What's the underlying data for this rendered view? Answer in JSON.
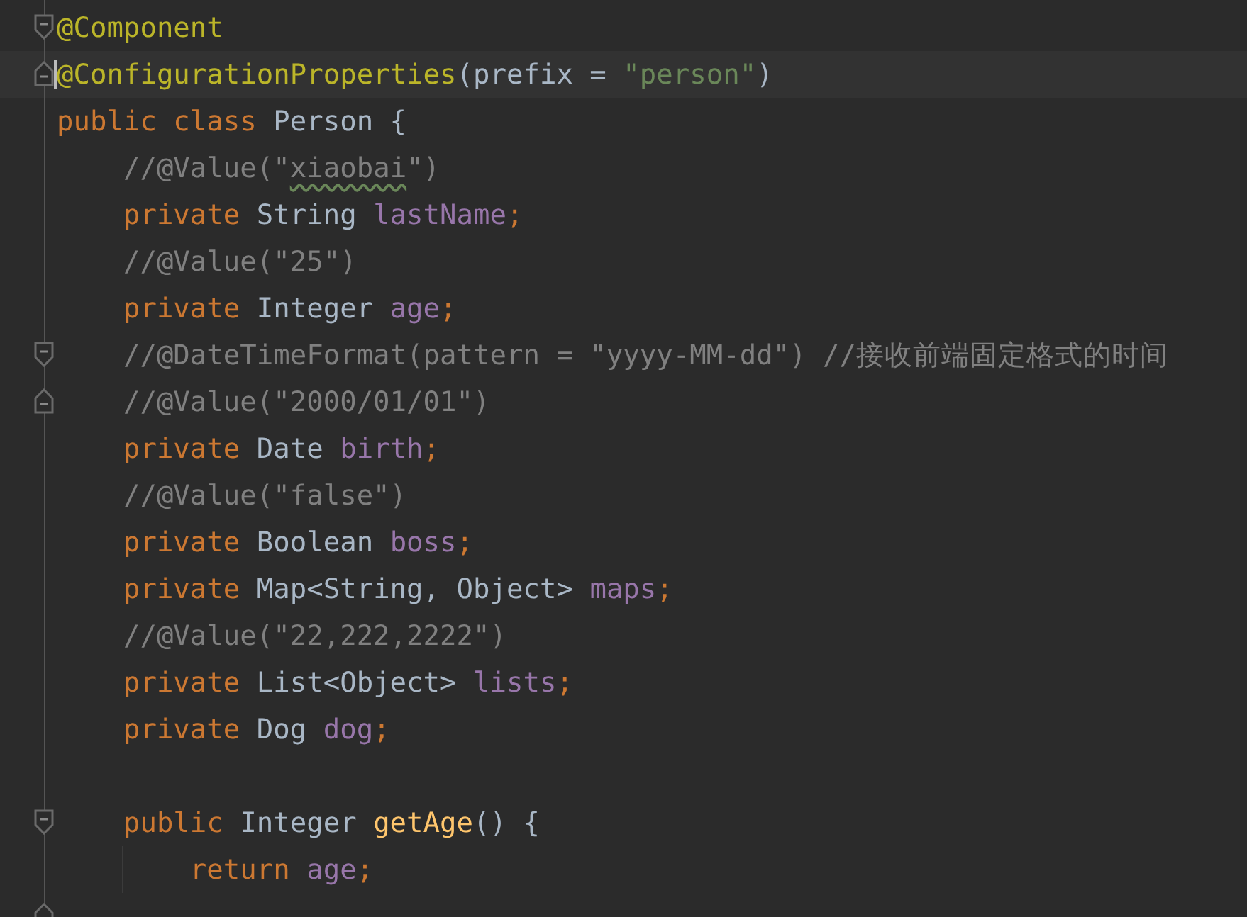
{
  "editor": {
    "lines": [
      {
        "fold_start": true,
        "tokens": [
          {
            "kind": "annotation",
            "text": "@Component"
          }
        ]
      },
      {
        "fold_end": true,
        "current": true,
        "tokens": [
          {
            "kind": "annotation",
            "text": "@ConfigurationProperties"
          },
          {
            "kind": "plain",
            "text": "(prefix = "
          },
          {
            "kind": "string",
            "text": "\"person\""
          },
          {
            "kind": "plain",
            "text": ")"
          }
        ]
      },
      {
        "tokens": [
          {
            "kind": "keyword",
            "text": "public class "
          },
          {
            "kind": "plain",
            "text": "Person {"
          }
        ]
      },
      {
        "tokens": [
          {
            "kind": "comment",
            "text": "    //@Value(\""
          },
          {
            "kind": "comment",
            "text": "xiaobai",
            "typo": true
          },
          {
            "kind": "comment",
            "text": "\")"
          }
        ]
      },
      {
        "tokens": [
          {
            "kind": "keyword",
            "text": "    private "
          },
          {
            "kind": "plain",
            "text": "String "
          },
          {
            "kind": "field",
            "text": "lastName"
          },
          {
            "kind": "keyword",
            "text": ";"
          }
        ]
      },
      {
        "tokens": [
          {
            "kind": "comment",
            "text": "    //@Value(\"25\")"
          }
        ]
      },
      {
        "tokens": [
          {
            "kind": "keyword",
            "text": "    private "
          },
          {
            "kind": "plain",
            "text": "Integer "
          },
          {
            "kind": "field",
            "text": "age"
          },
          {
            "kind": "keyword",
            "text": ";"
          }
        ]
      },
      {
        "fold_start": true,
        "tokens": [
          {
            "kind": "comment",
            "text": "    //@DateTimeFormat(pattern = \"yyyy-MM-dd\") //接收前端固定格式的时间"
          }
        ]
      },
      {
        "fold_end": true,
        "tokens": [
          {
            "kind": "comment",
            "text": "    //@Value(\"2000/01/01\")"
          }
        ]
      },
      {
        "tokens": [
          {
            "kind": "keyword",
            "text": "    private "
          },
          {
            "kind": "plain",
            "text": "Date "
          },
          {
            "kind": "field",
            "text": "birth"
          },
          {
            "kind": "keyword",
            "text": ";"
          }
        ]
      },
      {
        "tokens": [
          {
            "kind": "comment",
            "text": "    //@Value(\"false\")"
          }
        ]
      },
      {
        "tokens": [
          {
            "kind": "keyword",
            "text": "    private "
          },
          {
            "kind": "plain",
            "text": "Boolean "
          },
          {
            "kind": "field",
            "text": "boss"
          },
          {
            "kind": "keyword",
            "text": ";"
          }
        ]
      },
      {
        "tokens": [
          {
            "kind": "keyword",
            "text": "    private "
          },
          {
            "kind": "plain",
            "text": "Map<String, Object> "
          },
          {
            "kind": "field",
            "text": "maps"
          },
          {
            "kind": "keyword",
            "text": ";"
          }
        ]
      },
      {
        "tokens": [
          {
            "kind": "comment",
            "text": "    //@Value(\"22,222,2222\")"
          }
        ]
      },
      {
        "tokens": [
          {
            "kind": "keyword",
            "text": "    private "
          },
          {
            "kind": "plain",
            "text": "List<Object> "
          },
          {
            "kind": "field",
            "text": "lists"
          },
          {
            "kind": "keyword",
            "text": ";"
          }
        ]
      },
      {
        "tokens": [
          {
            "kind": "keyword",
            "text": "    private "
          },
          {
            "kind": "plain",
            "text": "Dog "
          },
          {
            "kind": "field",
            "text": "dog"
          },
          {
            "kind": "keyword",
            "text": ";"
          }
        ]
      },
      {
        "kind": "blank"
      },
      {
        "fold_start": true,
        "tokens": [
          {
            "kind": "keyword",
            "text": "    public "
          },
          {
            "kind": "plain",
            "text": "Integer "
          },
          {
            "kind": "method",
            "text": "getAge"
          },
          {
            "kind": "plain",
            "text": "() {"
          }
        ]
      },
      {
        "guide": true,
        "tokens": [
          {
            "kind": "keyword",
            "text": "        return "
          },
          {
            "kind": "field",
            "text": "age"
          },
          {
            "kind": "keyword",
            "text": ";"
          }
        ]
      },
      {
        "kind": "blank",
        "fold_end": true
      }
    ]
  }
}
